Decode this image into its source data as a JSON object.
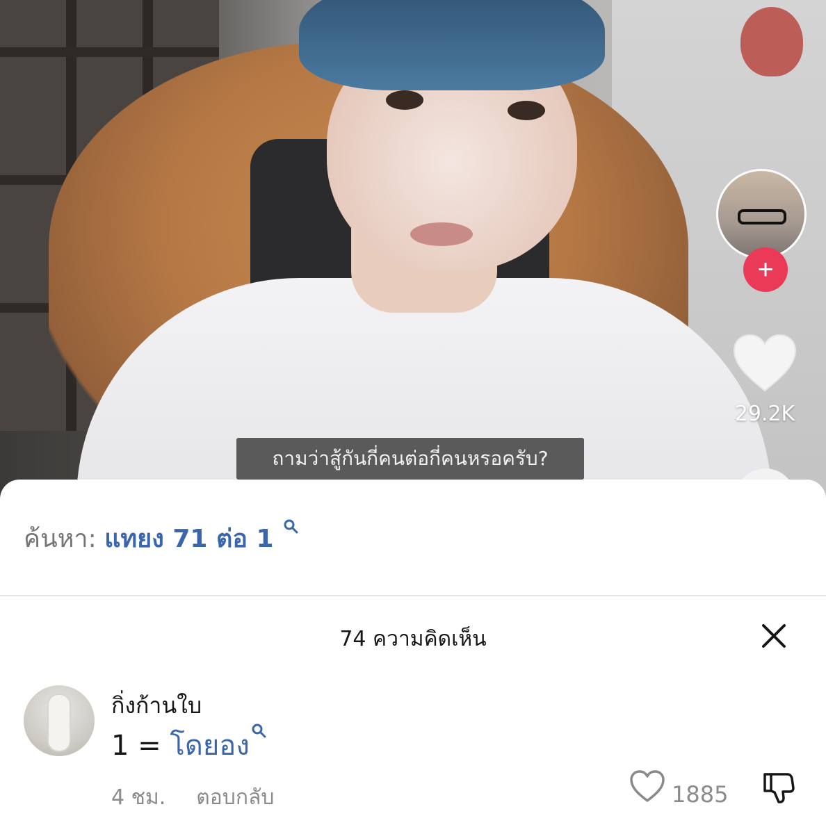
{
  "video": {
    "subtitle": "ถามว่าสู้กันกี่คนต่อกี่คนหรอครับ?",
    "likes": "29.2K"
  },
  "search": {
    "prefix": "ค้นหา:",
    "term": "แทยง 71 ต่อ 1"
  },
  "comments": {
    "title": "74 ความคิดเห็น",
    "items": [
      {
        "username": "กิ่งก้านใบ",
        "text_prefix": "1 = ",
        "text_link": "โดยอง",
        "time": "4 ชม.",
        "reply_label": "ตอบกลับ",
        "likes": "1885"
      }
    ]
  },
  "icons": {
    "follow": "plus-icon",
    "like": "heart-icon",
    "search": "search-icon",
    "close": "close-icon",
    "dislike": "thumbs-down-icon"
  },
  "colors": {
    "accent_link": "#3a66ad",
    "follow_button": "#ea3a58",
    "muted_text": "#8a8a8a"
  }
}
